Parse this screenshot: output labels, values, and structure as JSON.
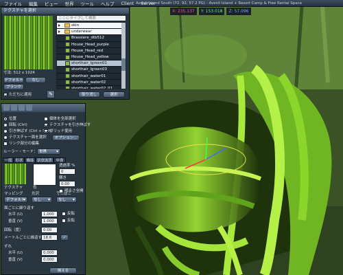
{
  "menu": [
    "ファイル",
    "編集",
    "ビュー",
    "世界",
    "ツール",
    "ヘルプ",
    "Client",
    "Server"
  ],
  "location": "Avenli Island South (72, 92, 57.2 PG) - Avenli Island + Resort Camp & Free Rental Space",
  "coords": {
    "x": "X: 235.137",
    "y": "Y: 153.018",
    "z": "Z: 57.096"
  },
  "texture_picker": {
    "title": "テクスチャを選択",
    "search_placeholder": "ここにタイプして検索",
    "items": [
      {
        "label": "skin",
        "type": "folder"
      },
      {
        "label": "underwear",
        "type": "folder"
      },
      {
        "label": "Brassiere_dtb512",
        "type": "item"
      },
      {
        "label": "House_Head_purple",
        "type": "item"
      },
      {
        "label": "House_Head_red",
        "type": "item"
      },
      {
        "label": "House_Head_yellow",
        "type": "item"
      },
      {
        "label": "shorthair_lgreen01",
        "type": "item",
        "selected": true
      },
      {
        "label": "shorthair_lgreen03",
        "type": "item"
      },
      {
        "label": "shorthair_water01",
        "type": "item"
      },
      {
        "label": "shorthair_water02",
        "type": "item"
      },
      {
        "label": "shorthair_water02_01",
        "type": "item"
      },
      {
        "label": "shorthair_water02_03",
        "type": "item"
      }
    ],
    "size_label": "寸法: 512 x 1024",
    "btn_default": "デフォルト",
    "btn_none": "なし",
    "btn_blank": "ブランク",
    "apply_now_label": "ただちに適用",
    "btn_cancel": "取り消し",
    "btn_ok": "選択"
  },
  "build": {
    "radios": [
      {
        "label": "位置",
        "on": true
      },
      {
        "label": "回転 (Ctrl)",
        "on": false
      },
      {
        "label": "引き伸ばす (Ctrl + Shift)",
        "on": false
      },
      {
        "label": "テクスチャー面を選択",
        "on": false
      }
    ],
    "checks_right": [
      {
        "label": "個体を全部選択",
        "on": false
      },
      {
        "label": "テクスチャを引き伸ばす",
        "on": true
      },
      {
        "label": "グリッド使用",
        "on": true
      }
    ],
    "grid_options_btn": "オプション...",
    "link_label": "リンク部分の編集",
    "ruler_label": "ルーラー・モード：",
    "ruler_value": "世界",
    "tabs": [
      "一般",
      "形状",
      "機能",
      "テクスチャ",
      "中身"
    ],
    "active_tab_index": 3,
    "texture_label": "テクスチャ",
    "color_label": "色",
    "transparency_label": "透過率 %",
    "transparency_value": "0",
    "glow_label": "輝き",
    "glow_value": "0.00",
    "full_bright_label": "明るさ全開",
    "mapping_label": "マッピング",
    "mapping_value": "デフォルト",
    "shininess_label": "光沢",
    "shininess_value": "なし",
    "bumpiness_label": "でこぼこ",
    "bumpiness_value": "なし",
    "repeats_header": "面ごとに繰り返す",
    "h_scale_label": "水平 (U)",
    "h_scale_value": "1.000",
    "v_scale_label": "垂直 (V)",
    "v_scale_value": "1.000",
    "flip_label": "反転",
    "rotation_label": "回転（度）",
    "rotation_value": "0.00",
    "repeats_per_meter_label": "メートルごとに繰返す",
    "repeats_per_meter_value": "18.6",
    "offset_label": "ずれ",
    "h_offset_label": "水平 (U)",
    "h_offset_value": "0.000",
    "v_offset_label": "垂直 (V)",
    "v_offset_value": "0.000",
    "align_btn": "揃える"
  },
  "colors": {
    "hair_bright": "#a6ee36",
    "hair_dark": "#142208",
    "panel": "#28343f"
  }
}
